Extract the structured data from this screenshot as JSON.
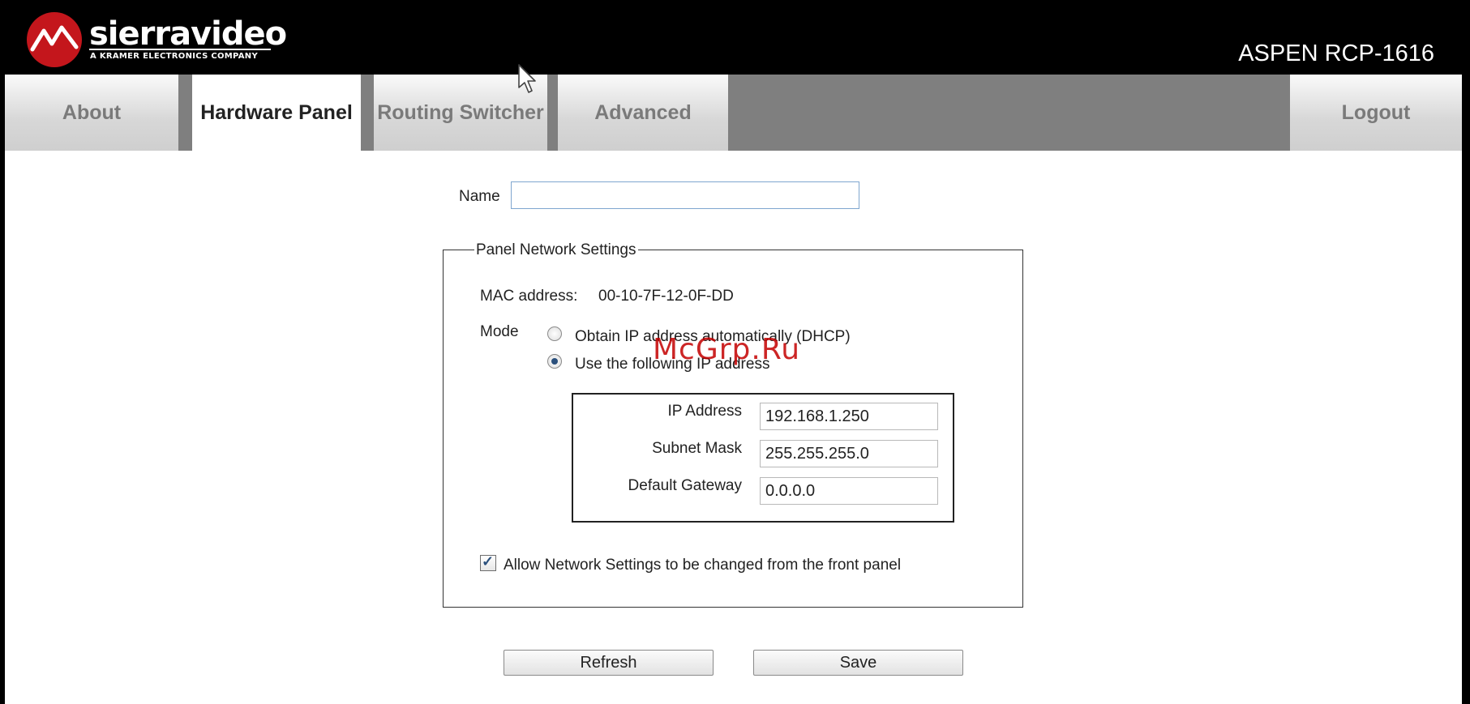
{
  "header": {
    "brand": "sierravideo",
    "brand_sub": "A KRAMER ELECTRONICS COMPANY",
    "product_title": "ASPEN RCP-1616"
  },
  "tabs": [
    {
      "label": "About",
      "active": false
    },
    {
      "label": "Hardware Panel",
      "active": true
    },
    {
      "label": "Routing Switcher",
      "active": false
    },
    {
      "label": "Advanced",
      "active": false
    },
    {
      "label": "Logout",
      "active": false
    }
  ],
  "form": {
    "name_label": "Name",
    "name_value": "",
    "network": {
      "legend": "Panel Network Settings",
      "mac_label": "MAC address:",
      "mac_value": "00-10-7F-12-0F-DD",
      "mode_label": "Mode",
      "mode_options": [
        {
          "label": "Obtain IP address automatically (DHCP)",
          "selected": false
        },
        {
          "label": "Use the following IP address",
          "selected": true
        }
      ],
      "ip_label": "IP Address",
      "ip_value": "192.168.1.250",
      "subnet_label": "Subnet Mask",
      "subnet_value": "255.255.255.0",
      "gateway_label": "Default Gateway",
      "gateway_value": "0.0.0.0",
      "allow_label": "Allow Network Settings to be changed from the front panel",
      "allow_checked": true
    },
    "refresh_label": "Refresh",
    "save_label": "Save"
  },
  "watermark": "McGrp.Ru",
  "colors": {
    "logo_red": "#c4161c",
    "tab_bar_gray": "#7f7f7f",
    "radio_blue": "#2a4f7c"
  }
}
